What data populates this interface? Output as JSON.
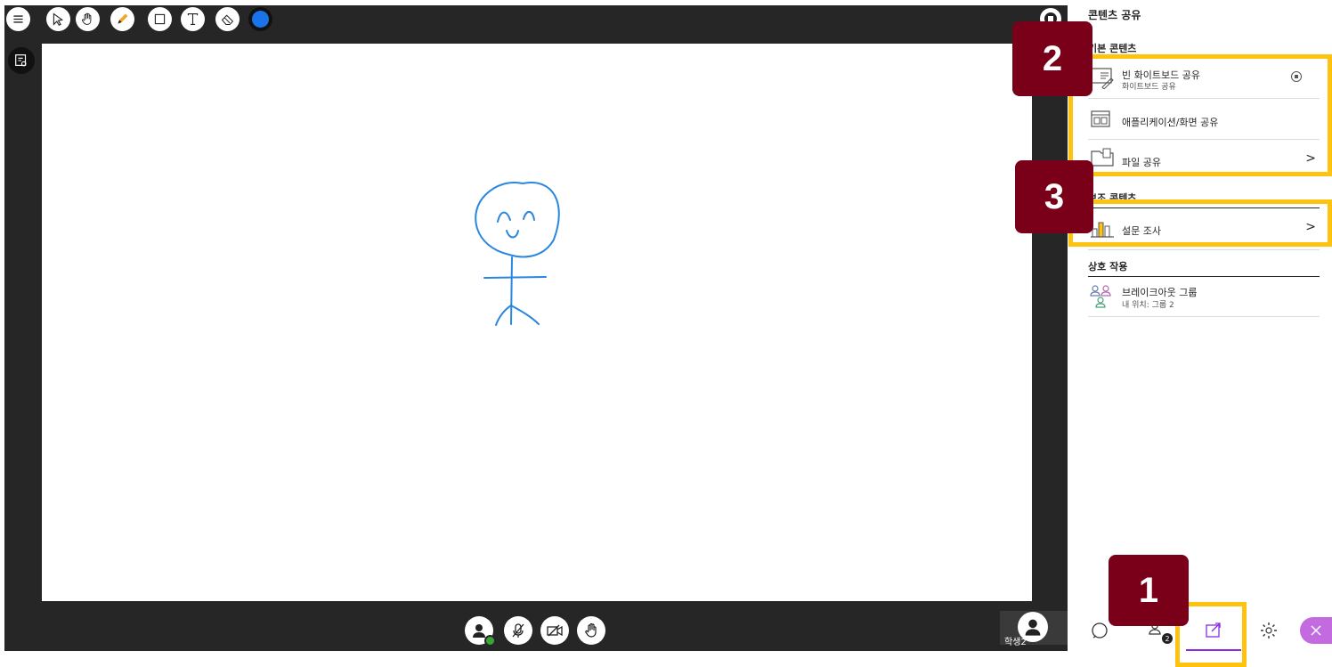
{
  "stage": {
    "self_name": "학생2",
    "pen_color": "#1a73e8",
    "tools": [
      "menu-icon",
      "select-icon",
      "pan-icon",
      "pencil-icon",
      "rectangle-icon",
      "text-icon",
      "eraser-icon",
      "color-icon"
    ]
  },
  "panel": {
    "title": "콘텐츠 공유",
    "primary_heading": "기본 콘텐츠",
    "items": [
      {
        "label": "빈 화이트보드 공유",
        "sub": "화이트보드 공유"
      },
      {
        "label": "애플리케이션/화면 공유"
      },
      {
        "label": "파일 공유",
        "chevron": ">"
      }
    ],
    "secondary_heading": "보조 콘텐츠",
    "secondary_items": [
      {
        "label": "설문 조사",
        "chevron": ">"
      }
    ],
    "interaction_heading": "상호 작용",
    "interaction_items": [
      {
        "label": "브레이크아웃 그룹",
        "sub": "내 위치: 그룹 2"
      }
    ],
    "attendee_count": "2"
  },
  "badges": [
    "1",
    "2",
    "3"
  ],
  "colors": {
    "accent": "#8a2be2",
    "highlight": "#ffc20e",
    "badge": "#7a0019",
    "dark": "#262626"
  }
}
